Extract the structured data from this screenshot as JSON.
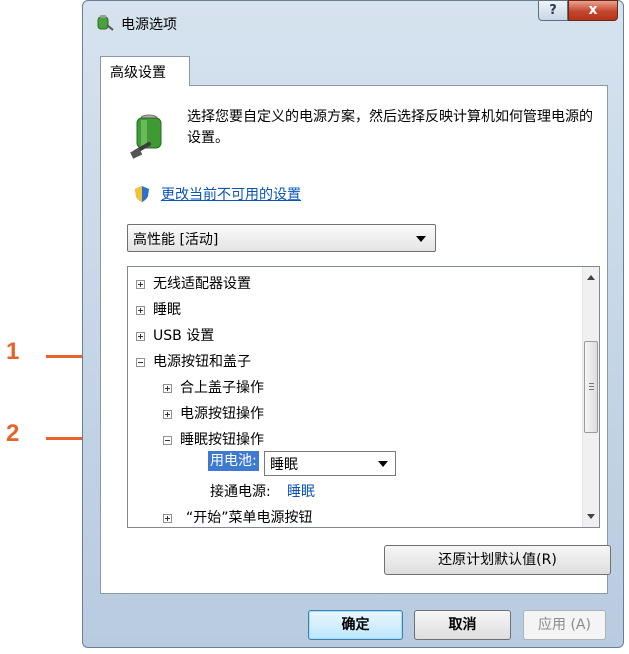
{
  "window": {
    "title": "电源选项",
    "help_label": "?",
    "close_label": "x"
  },
  "tab": {
    "label": "高级设置"
  },
  "intro": {
    "text": "选择您要自定义的电源方案，然后选择反映计算机如何管理电源的设置。"
  },
  "change_link": {
    "text": "更改当前不可用的设置"
  },
  "plan_select": {
    "value": "高性能 [活动]"
  },
  "tree": {
    "items": [
      {
        "label": "无线适配器设置",
        "expanded": false
      },
      {
        "label": "睡眠",
        "expanded": false
      },
      {
        "label": "USB 设置",
        "expanded": false
      },
      {
        "label": "电源按钮和盖子",
        "expanded": true
      },
      {
        "label": "合上盖子操作",
        "expanded": false
      },
      {
        "label": "电源按钮操作",
        "expanded": false
      },
      {
        "label": "睡眠按钮操作",
        "expanded": true
      },
      {
        "label": "“开始”菜单电源按钮",
        "expanded": false
      }
    ],
    "on_battery_label": "用电池:",
    "on_battery_value": "睡眠",
    "plugged_in_label": "接通电源:",
    "plugged_in_value": "睡眠"
  },
  "buttons": {
    "restore_default": "还原计划默认值(R)",
    "ok": "确定",
    "cancel": "取消",
    "apply": "应用 (A)"
  },
  "callouts": {
    "one": "1",
    "two": "2"
  },
  "colors": {
    "callout": "#e8622a",
    "link": "#0a55b5",
    "selection": "#3f7ad1"
  }
}
